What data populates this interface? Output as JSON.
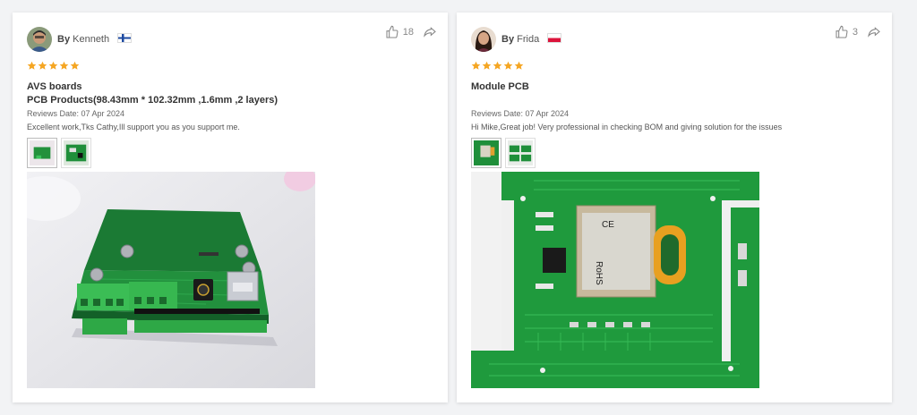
{
  "reviews": [
    {
      "by_label": "By",
      "name": "Kenneth",
      "likes": "18",
      "rating": 5,
      "title": "AVS boards",
      "product": "PCB Products(98.43mm * 102.32mm ,1.6mm ,2 layers)",
      "date": "Reviews Date: 07 Apr 2024",
      "comment": "Excellent work,Tks Cathy,Ill support you as you support me.",
      "thumbnail_count": 2
    },
    {
      "by_label": "By",
      "name": "Frida",
      "likes": "3",
      "rating": 5,
      "title": "Module PCB",
      "product": "",
      "date": "Reviews Date: 07 Apr 2024",
      "comment": "Hi Mike,Great job! Very professional in checking BOM and giving solution for the issues",
      "thumbnail_count": 2
    }
  ],
  "colors": {
    "star": "#f5a623",
    "pcb_green": "#1f8f3a",
    "text": "#333333"
  },
  "icons": [
    "thumbs-up-icon",
    "share-icon",
    "star-icon",
    "flag-icon"
  ]
}
